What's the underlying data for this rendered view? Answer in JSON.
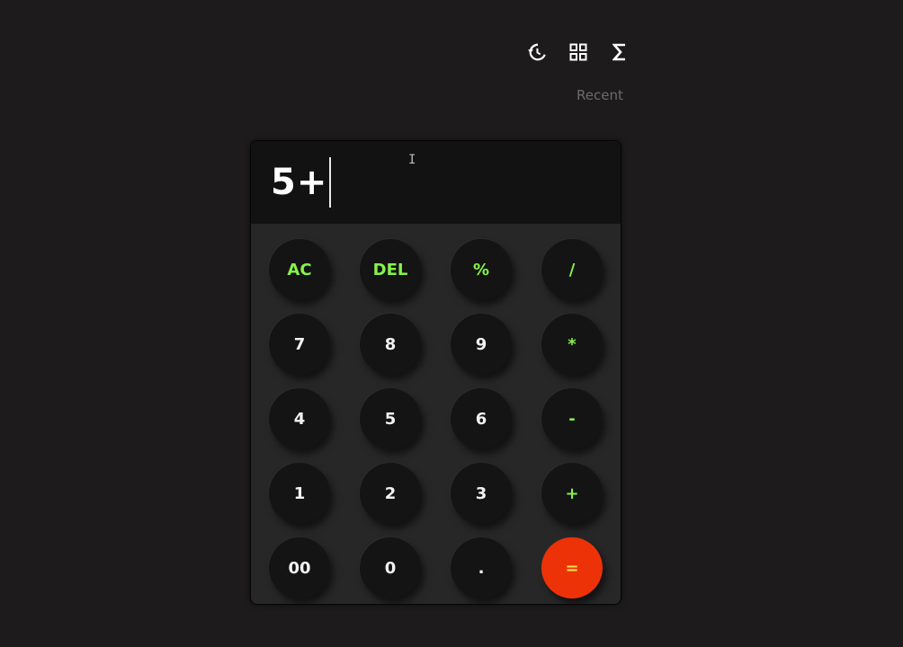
{
  "toolbar": {
    "history_icon": "history-icon",
    "grid_icon": "grid-icon",
    "sigma_icon": "sigma-icon"
  },
  "recent_label": "Recent",
  "display": {
    "value": "5+"
  },
  "keys": [
    {
      "label": "AC",
      "kind": "fn"
    },
    {
      "label": "DEL",
      "kind": "fn"
    },
    {
      "label": "%",
      "kind": "fn"
    },
    {
      "label": "/",
      "kind": "fn"
    },
    {
      "label": "7",
      "kind": "num"
    },
    {
      "label": "8",
      "kind": "num"
    },
    {
      "label": "9",
      "kind": "num"
    },
    {
      "label": "*",
      "kind": "fn"
    },
    {
      "label": "4",
      "kind": "num"
    },
    {
      "label": "5",
      "kind": "num"
    },
    {
      "label": "6",
      "kind": "num"
    },
    {
      "label": "-",
      "kind": "fn"
    },
    {
      "label": "1",
      "kind": "num"
    },
    {
      "label": "2",
      "kind": "num"
    },
    {
      "label": "3",
      "kind": "num"
    },
    {
      "label": "+",
      "kind": "fn"
    },
    {
      "label": "00",
      "kind": "num"
    },
    {
      "label": "0",
      "kind": "num"
    },
    {
      "label": ".",
      "kind": "num"
    },
    {
      "label": "=",
      "kind": "eq"
    }
  ],
  "colors": {
    "background": "#1d1b1c",
    "operator": "#86f24a",
    "equals_bg": "#ed3208",
    "equals_text": "#f3dd4e"
  }
}
